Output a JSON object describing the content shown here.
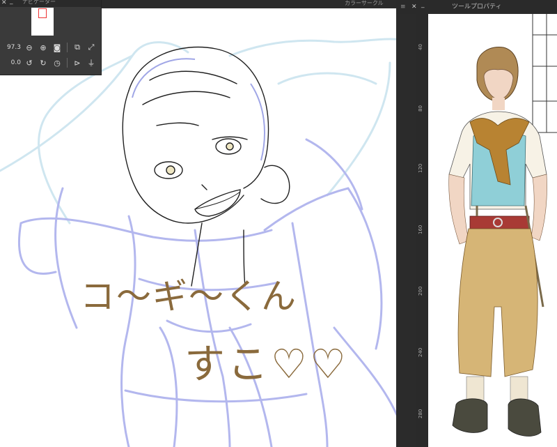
{
  "navigator": {
    "title": "ナビゲーター",
    "zoom_value": "97.3",
    "rotation_value": "0.0"
  },
  "top_panel": {
    "title": "カラーサークル"
  },
  "tool_property": {
    "title": "ツールプロパティ"
  },
  "ruler": {
    "ticks": [
      "40",
      "80",
      "120",
      "160",
      "200",
      "240",
      "280"
    ]
  },
  "sketch": {
    "line1": "コ〜ギ〜くん",
    "line2": "すこ♡♡"
  },
  "colors": {
    "panel_bg": "#2b2b2b",
    "sketch_blue": "#a9aee8",
    "ink": "#1f1f1f",
    "handwriting": "#8a6a3c",
    "ref_vest": "#8fcfd7",
    "ref_pants": "#d6b576",
    "ref_scarf": "#b88332",
    "ref_belt": "#a83a35"
  }
}
